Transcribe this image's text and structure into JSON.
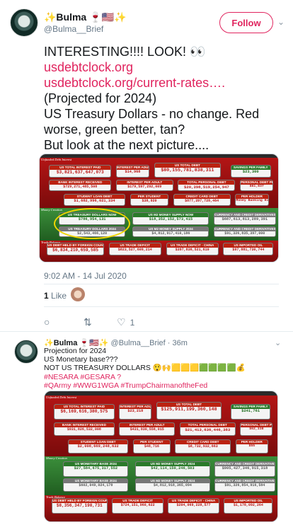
{
  "tweet1": {
    "display_name": "✨Bulma 🍷🇺🇸✨",
    "handle": "@Bulma__Brief",
    "follow_label": "Follow",
    "lines": [
      "INTERESTING!!!! LOOK! 👀"
    ],
    "link1": "usdebtclock.org",
    "link2": "usdebtclock.org/current-rates….",
    "lines2": [
      "(Projected for 2024)",
      "US Treasury Dollars - no change. Red worse, green better, tan?",
      "But look at the next picture...."
    ],
    "timestamp": "9:02 AM - 14 Jul 2020",
    "like_count": "1",
    "like_label": "Like",
    "reply_count": "",
    "retweet_count": "",
    "heart_count": "1"
  },
  "clock1": {
    "section_top": "Unfunded Debt Interest",
    "section_money": "Money Creation",
    "section_trade": "Trade Balance",
    "cells": [
      {
        "label": "US TOTAL INTEREST PAID",
        "value": "$3,821,637,647,073"
      },
      {
        "label": "INTEREST PER ADULT",
        "value": "$14,968"
      },
      {
        "label": "US TOTAL DEBT",
        "value": "$80,155,781,838,311"
      },
      {
        "label": "SAVINGS PER FAMILY",
        "value": "$23,300"
      },
      {
        "label": "BANK INTEREST RECEIVED",
        "value": "$729,271,485,508"
      },
      {
        "label": "INTEREST PER ADULT",
        "value": "$179,597,292,009"
      },
      {
        "label": "TOTAL PERSONAL DEBT",
        "value": "$20,398,519,254,947"
      },
      {
        "label": "PERSONAL DEBT PER CIT",
        "value": "$61,837"
      },
      {
        "label": "STUDENT LOAN DEBT",
        "value": "$1,682,996,021,334"
      },
      {
        "label": "PER STUDENT",
        "value": "$38,920"
      },
      {
        "label": "CREDIT CARD DEBT",
        "value": "$877,397,728,464"
      },
      {
        "label": "PER HOLDER",
        "value": "Money Banking History"
      },
      {
        "label": "US TREASURY DOLLARS NOW",
        "value": "$786,954,131"
      },
      {
        "label": "US TREASURY DOLLARS 2024",
        "value": "$2,543,466,120"
      },
      {
        "label": "US M2 MONEY SUPPLY NOW",
        "value": "$18,352,152,573,415"
      },
      {
        "label": "US M2 MONEY SUPPLY 2024",
        "value": "$4,812,917,410,186"
      },
      {
        "label": "CURRENCY AND CREDIT DERIVATIVES NOW",
        "value": "$687,613,813,289,391"
      },
      {
        "label": "CURRENCY AND CREDIT DERIVATIVES 2024",
        "value": "$91,326,835,397,000"
      },
      {
        "label": "US DEBT HELD BY FOREIGN COUNTRIES",
        "value": "$6,834,210,659,585"
      },
      {
        "label": "US TRADE DEFICIT",
        "value": "$823,527,609,214"
      },
      {
        "label": "US TRADE DEFICIT - CHINA",
        "value": "$397,836,521,610"
      },
      {
        "label": "US IMPORTED OIL",
        "value": "$97,881,730,744"
      }
    ]
  },
  "tweet2": {
    "display_name": "✨Bulma 🍷🇺🇸✨",
    "handle": "@Bulma__Brief · 36m",
    "lines": [
      "Projection for 2024",
      "US Monetary base???",
      "NOT US TREASURY DOLLARS 😲🙌🟨🟨🟨🟩🟩🟩🟩💰"
    ],
    "tags1": "#NESARA  #GESARA ?",
    "tags2": "#QArmy #WWG1WGA #TrumpChairmanoftheFed"
  },
  "clock2": {
    "section_top": "Unfunded Debt Interest",
    "section_money": "Money Creation",
    "section_trade": "Trade Balance",
    "cells": [
      {
        "label": "US TOTAL INTEREST PAID",
        "value": "$6,169,616,380,575"
      },
      {
        "label": "INTEREST PER ADULT",
        "value": "$23,218"
      },
      {
        "label": "US TOTAL DEBT",
        "value": "$125,911,199,360,148"
      },
      {
        "label": "SAVINGS PER FAMILY",
        "value": "$241,761"
      },
      {
        "label": "BANK INTEREST RECEIVED",
        "value": "$931,826,532,008"
      },
      {
        "label": "INTEREST PER ADULT",
        "value": "$431,930,558,015"
      },
      {
        "label": "TOTAL PERSONAL DEBT",
        "value": "$21,413,636,446,383"
      },
      {
        "label": "PERSONAL DEBT PER CIT",
        "value": "$62,338"
      },
      {
        "label": "STUDENT LOAN DEBT",
        "value": "$2,008,669,248,632"
      },
      {
        "label": "PER STUDENT",
        "value": "$48,716"
      },
      {
        "label": "CREDIT CARD DEBT",
        "value": "$8,732,932,663"
      },
      {
        "label": "PER HOLDER",
        "value": "$55"
      },
      {
        "label": "US MONETARY BASE 2024",
        "value": "$27,584,675,317,552"
      },
      {
        "label": "US MONETARY BASE 2024",
        "value": "$602,049,024,178"
      },
      {
        "label": "US M2 MONEY SUPPLY 2024",
        "value": "$42,114,150,246,503"
      },
      {
        "label": "US M2 MONEY SUPPLY 2024",
        "value": "$4,812,918,365,094"
      },
      {
        "label": "CURRENCY AND CREDIT DERIVATIVES 2024",
        "value": "$905,427,346,915,318"
      },
      {
        "label": "CURRENCY AND CREDIT DERIVATIVES 2024",
        "value": "$91,326,854,916,584"
      },
      {
        "label": "US DEBT HELD BY FOREIGN COUNTRIES",
        "value": "$8,356,347,198,731"
      },
      {
        "label": "US TRADE DEFICIT",
        "value": "$724,151,960,622"
      },
      {
        "label": "US TRADE DEFICIT - CHINA",
        "value": "$204,069,228,577"
      },
      {
        "label": "US IMPORTED OIL",
        "value": "$1,178,092,264"
      }
    ]
  }
}
